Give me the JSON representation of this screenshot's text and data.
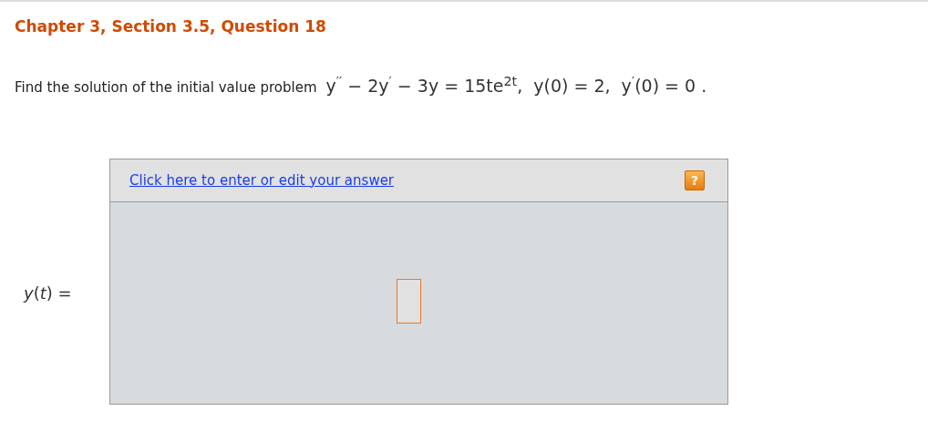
{
  "title": "Chapter 3, Section 3.5, Question 18",
  "question": {
    "prompt": "Find the solution of the initial value problem",
    "equation": "y$^{′′}$ − 2y$^{′}$ − 3y = 15te$^{2t}$,  y(0) = 2,  y$^{′}$(0) = 0 ."
  },
  "answer": {
    "label": "*y*(*t*) =",
    "link": "Click here to enter or edit your answer",
    "help": "?"
  }
}
